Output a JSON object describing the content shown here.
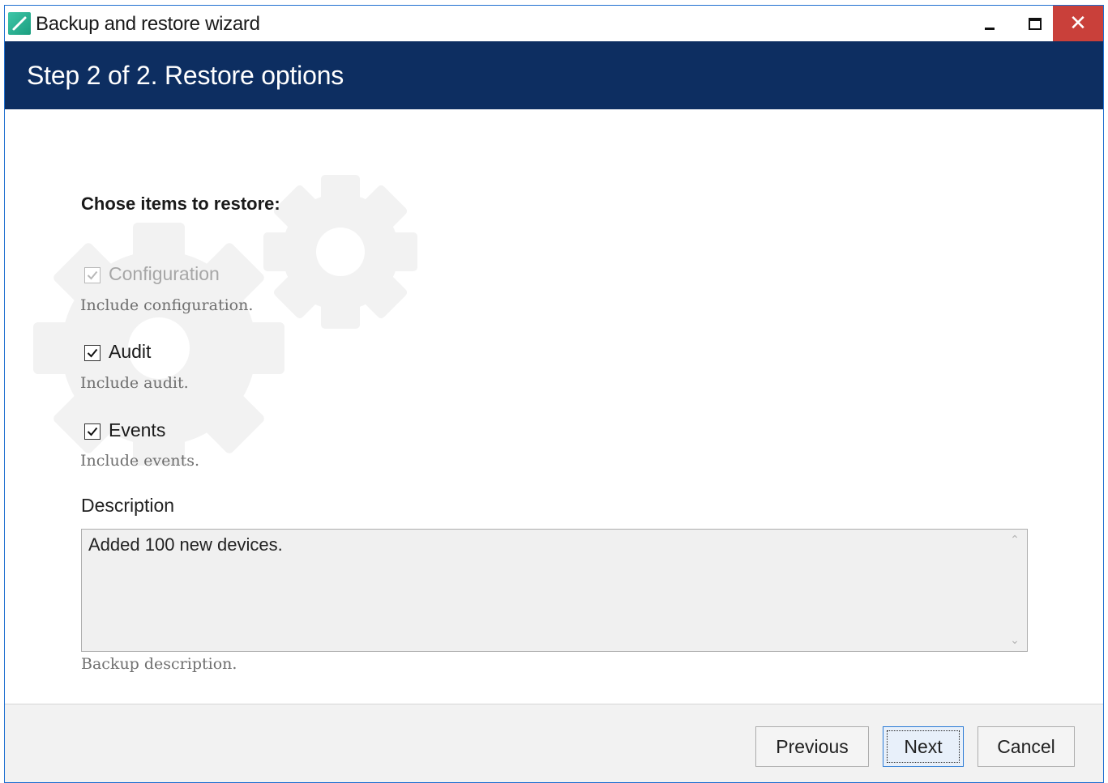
{
  "window": {
    "title": "Backup and restore wizard",
    "close_glyph": "✕",
    "app_icon": "app-logo-icon"
  },
  "header": {
    "title": "Step 2 of 2. Restore options"
  },
  "restore": {
    "section_title": "Chose items to restore:",
    "options": [
      {
        "label": "Configuration",
        "help": "Include configuration.",
        "checked": true,
        "disabled": true
      },
      {
        "label": "Audit",
        "help": "Include audit.",
        "checked": true,
        "disabled": false
      },
      {
        "label": "Events",
        "help": "Include events.",
        "checked": true,
        "disabled": false
      }
    ]
  },
  "description": {
    "label": "Description",
    "value": "Added 100 new devices.",
    "help": "Backup description.",
    "scroll_up": "^",
    "scroll_down": "v"
  },
  "footer": {
    "previous_label": "Previous",
    "next_label": "Next",
    "cancel_label": "Cancel"
  },
  "colors": {
    "header_bg": "#0d2e61",
    "close_bg": "#c9403a",
    "window_border": "#1e6fd0"
  }
}
